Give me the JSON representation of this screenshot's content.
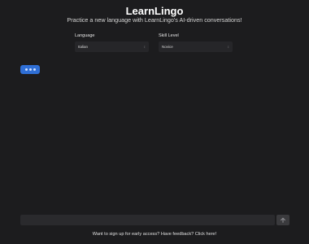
{
  "header": {
    "title": "LearnLingo",
    "subtitle": "Practice a new language with LearnLingo's AI-driven conversations!"
  },
  "settings": {
    "language": {
      "label": "Language",
      "selected": "Italian",
      "chevron_icon": "chevron-up-down-icon"
    },
    "skill_level": {
      "label": "Skill Level",
      "selected": "Novice",
      "chevron_icon": "chevron-up-down-icon"
    }
  },
  "chat": {
    "typing_indicator": "typing-dots-icon",
    "accent_color": "#2f6fd6"
  },
  "composer": {
    "input_value": "",
    "send_icon": "send-arrow-icon"
  },
  "footer": {
    "text": "Want to sign up for early access? Have feedback? Click here!"
  }
}
